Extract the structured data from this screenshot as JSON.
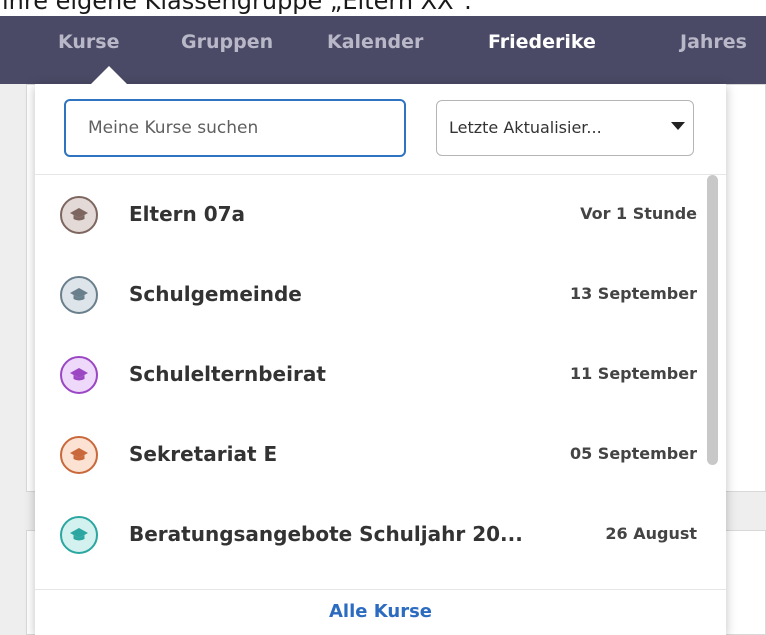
{
  "caption": "ihre eigene Klassengruppe „Eltern XX“.",
  "nav": {
    "items": [
      {
        "label": "Kurse",
        "active": false
      },
      {
        "label": "Gruppen",
        "active": false
      },
      {
        "label": "Kalender",
        "active": false
      },
      {
        "label": "Friederike",
        "active": true
      },
      {
        "label": "Jahres",
        "active": false
      }
    ]
  },
  "search": {
    "placeholder": "Meine Kurse suchen",
    "value": ""
  },
  "sort": {
    "selected": "Letzte Aktualisier..."
  },
  "courses": [
    {
      "name": "Eltern 07a",
      "date": "Vor 1 Stunde",
      "icon": "graduation-cap-icon",
      "color": "#7d665f",
      "bg": "#e3d9d6"
    },
    {
      "name": "Schulgemeinde",
      "date": "13 September",
      "icon": "graduation-cap-icon",
      "color": "#6a7f8c",
      "bg": "#dde5ea"
    },
    {
      "name": "Schulelternbeirat",
      "date": "11 September",
      "icon": "graduation-cap-icon",
      "color": "#9b47c4",
      "bg": "#efd9fa"
    },
    {
      "name": "Sekretariat E",
      "date": "05 September",
      "icon": "graduation-cap-icon",
      "color": "#c9683a",
      "bg": "#fbe2d3"
    },
    {
      "name": "Beratungsangebote Schuljahr 20...",
      "date": "26 August",
      "icon": "graduation-cap-icon",
      "color": "#2ba6a0",
      "bg": "#d3f2ef"
    }
  ],
  "footer": {
    "all_courses_label": "Alle Kurse"
  },
  "colors": {
    "nav_bg": "#4b4a66",
    "accent": "#2b6bc0",
    "input_border": "#2f74c0"
  }
}
